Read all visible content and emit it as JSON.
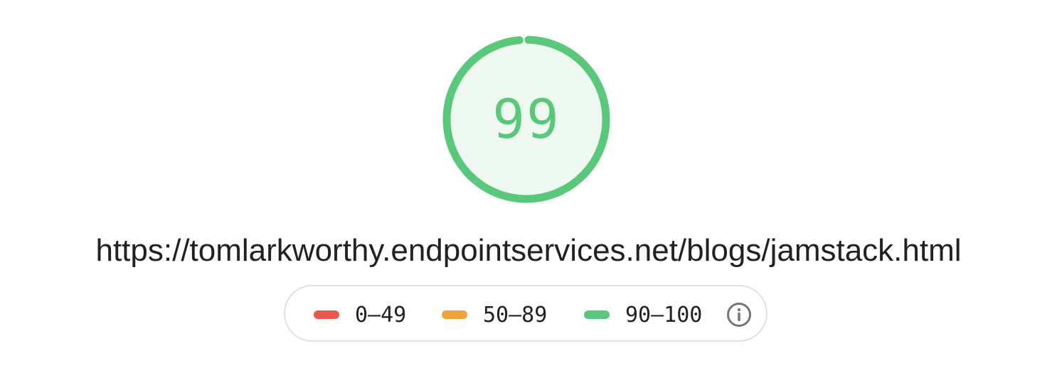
{
  "score": {
    "value": "99",
    "progress": 0.99,
    "color": "#5ac87a",
    "fill_color": "#eef8f0"
  },
  "url": "https://tomlarkworthy.endpointservices.net/blogs/jamstack.html",
  "legend": {
    "items": [
      {
        "label": "0–49",
        "color": "#e8594a"
      },
      {
        "label": "50–89",
        "color": "#f2a23a"
      },
      {
        "label": "90–100",
        "color": "#5ac87a"
      }
    ],
    "info_icon": "info-icon"
  }
}
